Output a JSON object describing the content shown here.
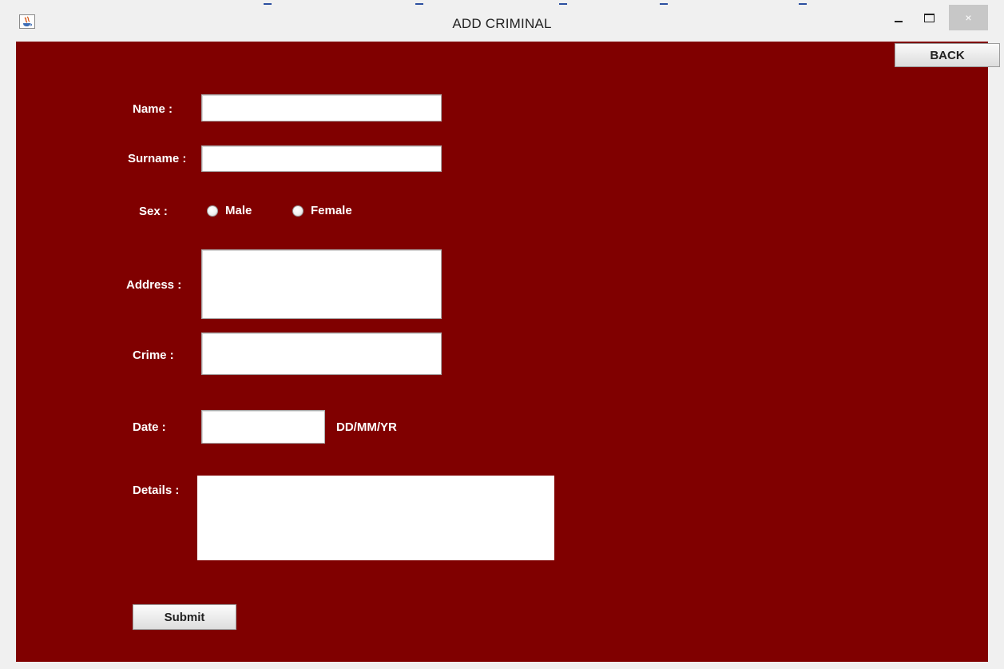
{
  "window": {
    "title": "ADD CRIMINAL",
    "app_icon": "java-icon",
    "minimize_icon": "minimize-icon",
    "maximize_icon": "maximize-icon",
    "close_glyph": "×"
  },
  "toolbar": {
    "back_label": "BACK"
  },
  "form": {
    "name_label": "Name :",
    "name_value": "",
    "surname_label": "Surname :",
    "surname_value": "",
    "sex_label": "Sex :",
    "sex_options": [
      "Male",
      "Female"
    ],
    "address_label": "Address :",
    "address_value": "",
    "crime_label": "Crime :",
    "crime_value": "",
    "date_label": "Date :",
    "date_value": "",
    "date_format_hint": "DD/MM/YR",
    "details_label": "Details :",
    "details_value": "",
    "submit_label": "Submit"
  },
  "colors": {
    "panel_background": "#800000",
    "window_chrome": "#f0f0f0",
    "field_background": "#ffffff",
    "label_text": "#ffffff"
  }
}
